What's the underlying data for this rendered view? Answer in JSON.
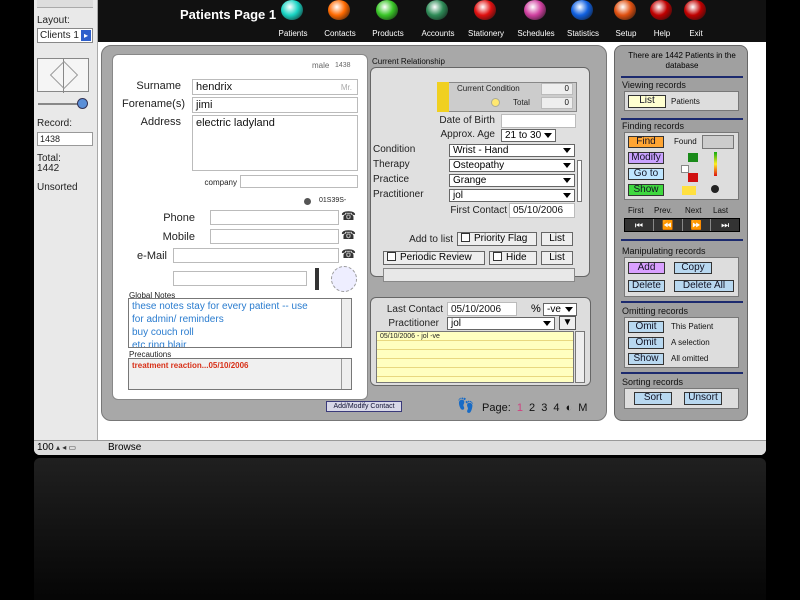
{
  "header": {
    "title": "Patients Page 1",
    "nav": [
      {
        "label": "Patients",
        "color": "#19d4c4"
      },
      {
        "label": "Contacts",
        "color": "#ff6a00"
      },
      {
        "label": "Products",
        "color": "#39c627"
      },
      {
        "label": "Accounts",
        "color": "#2e8b57"
      },
      {
        "label": "Stationery",
        "color": "#e01010"
      },
      {
        "label": "Schedules",
        "color": "#d040a0"
      },
      {
        "label": "Statistics",
        "color": "#1060e0"
      },
      {
        "label": "Setup",
        "color": "#e05010"
      },
      {
        "label": "Help",
        "color": "#c00000"
      },
      {
        "label": "Exit",
        "color": "#c00000"
      }
    ]
  },
  "sidebar": {
    "layout_label": "Layout:",
    "layout_value": "Clients 1",
    "record_label": "Record:",
    "record_value": "1438",
    "total_label": "Total:",
    "total_value": "1442",
    "sort_status": "Unsorted",
    "zoom": "100",
    "mode": "Browse"
  },
  "patient": {
    "gender_tag": "male",
    "id_tag": "1438",
    "surname_label": "Surname",
    "surname": "hendrix",
    "title_suffix": "Mr.",
    "forename_label": "Forename(s)",
    "forename": "jimi",
    "address_label": "Address",
    "address": "electric ladyland",
    "company_label": "company",
    "ref_code": "01S39S-",
    "phone_label": "Phone",
    "mobile_label": "Mobile",
    "email_label": "e-Mail",
    "global_notes_label": "Global Notes",
    "global_notes": [
      "these notes stay for every patient -- use",
      "for admin/ reminders",
      "buy couch roll",
      "etc ring blair"
    ],
    "precautions_label": "Precautions",
    "precautions": "treatment reaction...05/10/2006"
  },
  "relationship": {
    "header": "Current Relationship",
    "current_condition_label": "Current Condition",
    "current_condition_value": "0",
    "total_label": "Total",
    "total_value": "0",
    "dob_label": "Date of Birth",
    "approx_age_label": "Approx. Age",
    "approx_age": "21 to  30",
    "condition_label": "Condition",
    "condition": "Wrist - Hand",
    "therapy_label": "Therapy",
    "therapy": "Osteopathy",
    "practice_label": "Practice",
    "practice": "Grange",
    "practitioner_label": "Practitioner",
    "practitioner": "jol",
    "first_contact_label": "First Contact",
    "first_contact": "05/10/2006",
    "add_to_list_label": "Add to list",
    "priority_flag_label": "Priority Flag",
    "list_label": "List",
    "periodic_review_label": "Periodic Review",
    "hide_label": "Hide"
  },
  "contact": {
    "last_contact_label": "Last Contact",
    "last_contact": "05/10/2006",
    "percent_label": "%",
    "percent_value": "-ve",
    "practitioner_label": "Practitioner",
    "practitioner": "jol",
    "log_entry": "05/10/2006 - jol  -ve"
  },
  "footer": {
    "add_modify_label": "Add/Modify Contact",
    "page_label": "Page:",
    "pages": [
      "1",
      "2",
      "3",
      "4"
    ],
    "current_page": "1",
    "m_label": "M"
  },
  "right": {
    "db_count_text": "There are 1442 Patients in the database",
    "viewing_label": "Viewing records",
    "list_btn": "List",
    "patients_text": "Patients",
    "finding_label": "Finding records",
    "find_btn": "Find",
    "found_label": "Found",
    "modify_btn": "Modify",
    "goto_btn": "Go to",
    "show_btn": "Show",
    "nav_first": "First",
    "nav_prev": "Prev.",
    "nav_next": "Next",
    "nav_last": "Last",
    "manipulating_label": "Manipulating records",
    "add_btn": "Add",
    "copy_btn": "Copy",
    "delete_btn": "Delete",
    "delete_all_btn": "Delete All",
    "omitting_label": "Omitting records",
    "omit_btn_1": "Omit",
    "omit_text_1": "This Patient",
    "omit_btn_2": "Omit",
    "omit_text_2": "A selection",
    "show_omit_btn": "Show",
    "show_omit_text": "All omitted",
    "sorting_label": "Sorting records",
    "sort_btn": "Sort",
    "unsort_btn": "Unsort"
  },
  "colors": {
    "find": "#ffa533",
    "modify": "#c9a2ff",
    "goto": "#bfe6ff",
    "show": "#3fd83f",
    "add": "#d9a0ff",
    "copy": "#b8d8f0",
    "delete": "#b8d8f0",
    "omit": "#b8d8f0",
    "sort": "#b8d8f0",
    "list": "#ffffd0"
  }
}
